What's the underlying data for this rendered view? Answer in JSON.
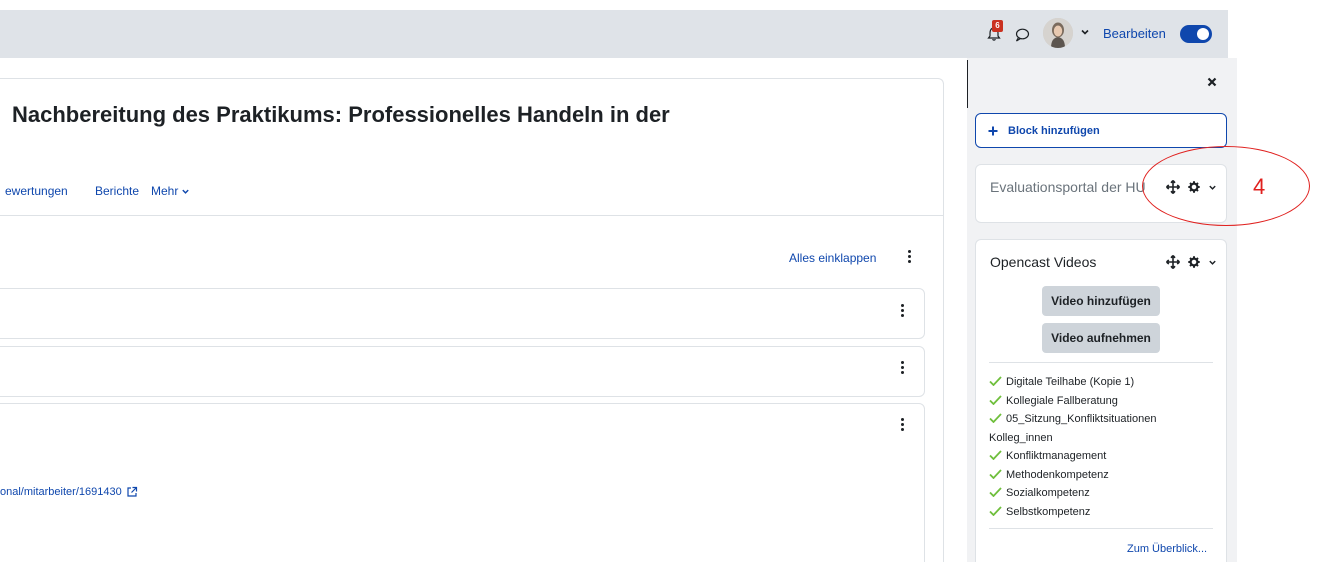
{
  "navbar": {
    "notification_count": "6",
    "edit_mode_label": "Bearbeiten",
    "edit_mode_on": true
  },
  "course": {
    "title": "Nachbereitung des Praktikums: Professionelles Handeln in der",
    "tabs": [
      "ewertungen",
      "Berichte"
    ],
    "more_label": "Mehr",
    "collapse_all": "Alles einklappen",
    "external_link": "onal/mitarbeiter/1691430"
  },
  "drawer": {
    "add_block": "Block hinzufügen",
    "blocks": [
      {
        "title": "Evaluationsportal der HU"
      },
      {
        "title": "Opencast Videos"
      }
    ],
    "opencast": {
      "add_video": "Video hinzufügen",
      "record_video": "Video aufnehmen",
      "videos": [
        "Digitale Teilhabe (Kopie 1)",
        "Kollegiale Fallberatung",
        "05_Sitzung_Konfliktsituationen Kolleg_innen",
        "Konfliktmanagement",
        "Methodenkompetenz",
        "Sozialkompetenz",
        "Selbstkompetenz"
      ],
      "overview_link": "Zum Überblick..."
    }
  },
  "annotation": {
    "number": "4",
    "color": "#e0201e"
  },
  "colors": {
    "link": "#0f47ad",
    "navbar": "#dfe3e8",
    "drawer": "#f1f2f4",
    "check": "#6fbf3c"
  }
}
